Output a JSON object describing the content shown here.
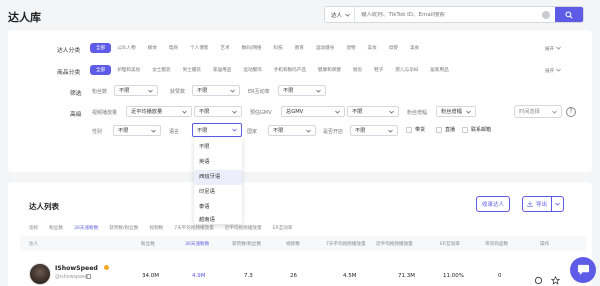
{
  "page": {
    "title": "达人库"
  },
  "search": {
    "scope": "达人",
    "placeholder": "输入昵称、TikTok ID、Email搜索"
  },
  "filters": {
    "creator_category": {
      "label": "达人分类",
      "items": [
        "全部",
        "公众人物",
        "媒体",
        "电商",
        "个人博客",
        "艺术",
        "数码/网络",
        "科技",
        "教育",
        "运动健身",
        "宠物",
        "美妆",
        "母婴",
        "美食"
      ],
      "more": "展开"
    },
    "product_category": {
      "label": "商品分类",
      "items": [
        "全部",
        "护理和美妆",
        "女士服装",
        "男士服装",
        "家居用品",
        "运动服饰",
        "手机和数码产品",
        "健康和保健",
        "厨房",
        "鞋子",
        "婴儿与孕妇",
        "居家用品"
      ],
      "more": "展开"
    },
    "filter": {
      "label": "筛选",
      "fans_label": "粉丝数",
      "fans_value": "不限",
      "likes_label": "获赞数",
      "likes_value": "不限",
      "er_label": "ER互动率",
      "er_value": "不限"
    },
    "advanced": {
      "label": "高级",
      "video_views_label": "视频播放量",
      "video_views_type": "近平均播放量",
      "video_views_value": "不限",
      "gmv_label": "预估GMV",
      "gmv_type": "总GMV",
      "gmv_value": "不限",
      "fans_growth_label": "粉丝增幅",
      "fans_growth_value": "粉丝增幅",
      "time_placeholder": "时间选择"
    },
    "row2": {
      "gender_label": "性别",
      "gender_value": "不限",
      "language_label": "语言",
      "language_value": "不限",
      "country_label": "国家",
      "country_value": "不限",
      "outbound_label": "是否开店",
      "outbound_value": "不限",
      "cb_goods": "带货",
      "cb_live": "直播",
      "cb_email": "联系邮箱"
    }
  },
  "language_menu": [
    "不限",
    "英语",
    "西班牙语",
    "印尼语",
    "泰语",
    "越南语"
  ],
  "list": {
    "title": "达人列表",
    "collect_button": "收录达人",
    "export_button": "导出",
    "tabs": [
      "指标",
      "粉丝数",
      "30天涨粉数",
      "获赞数/粉丝数",
      "视频数",
      "7天平均视频播放量",
      "近平均视频播放量",
      "ER互动率"
    ],
    "columns": [
      "达人",
      "粉丝数",
      "30天涨粉数",
      "获赞数/粉丝数",
      "视频数",
      "7天平均视频播放量",
      "近平均视频播放量",
      "ER互动率",
      "带货商品数",
      "操作"
    ],
    "rows": [
      {
        "name": "IShowSpeed",
        "handle": "@ishowspeed",
        "fans": "34.0M",
        "growth": "4.9M",
        "ratio": "7.3",
        "videos": "26",
        "avg7": "4.5M",
        "avg_recent": "71.3M",
        "er": "11.00%",
        "goods": "0"
      }
    ]
  },
  "colors": {
    "accent": "#5e5ce6",
    "badge": "#f5a623"
  }
}
